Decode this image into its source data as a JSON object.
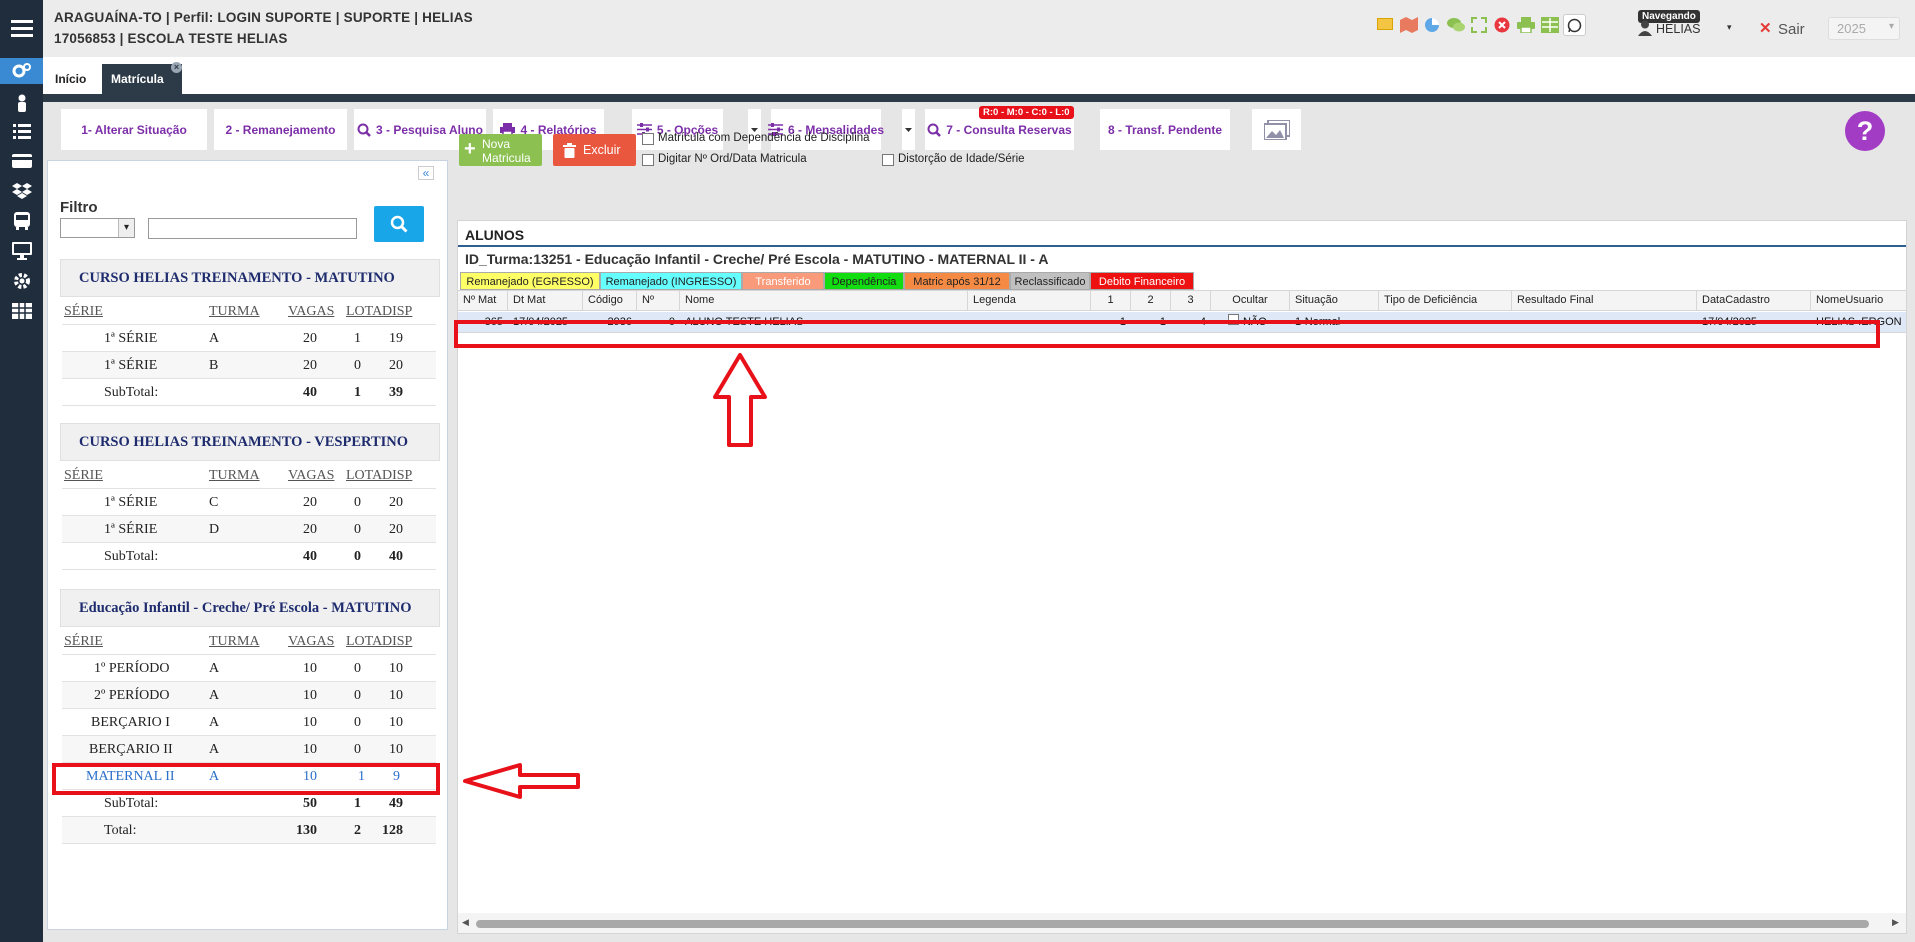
{
  "header": {
    "line1": "ARAGUAÍNA-TO | Perfil: LOGIN SUPORTE | SUPORTE | HELIAS",
    "line2": "17056853 | ESCOLA TESTE HELIAS",
    "user": "HELIAS",
    "navegando_badge": "Navegando",
    "exit_label": "Sair",
    "year": "2025"
  },
  "tabs": [
    {
      "label": "Início"
    },
    {
      "label": "Matrícula"
    }
  ],
  "toolbar": {
    "btn1": "1- Alterar Situação",
    "btn2": "2 - Remanejamento",
    "btn3": "3 - Pesquisa Aluno",
    "btn4": "4 - Relatórios",
    "btn5": "5 - Opções",
    "btn6": "6 - Mensalidades",
    "btn7": "7 - Consulta Reservas",
    "btn7_badge": "R:0 - M:0 - C:0 - L:0",
    "btn8": "8 - Transf. Pendente"
  },
  "filter": {
    "label": "Filtro",
    "select_value": "",
    "search_value": ""
  },
  "courses": [
    {
      "title": "CURSO HELIAS TREINAMENTO - MATUTINO",
      "headers": [
        "SÉRIE",
        "TURMA",
        "VAGAS",
        "LOTA",
        "DISP"
      ],
      "rows": [
        [
          "1ª SÉRIE",
          "A",
          "20",
          "1",
          "19"
        ],
        [
          "1ª SÉRIE",
          "B",
          "20",
          "0",
          "20"
        ]
      ],
      "subtotal": [
        "SubTotal:",
        "40",
        "1",
        "39"
      ]
    },
    {
      "title": "CURSO HELIAS TREINAMENTO - VESPERTINO",
      "headers": [
        "SÉRIE",
        "TURMA",
        "VAGAS",
        "LOTA",
        "DISP"
      ],
      "rows": [
        [
          "1ª SÉRIE",
          "C",
          "20",
          "0",
          "20"
        ],
        [
          "1ª SÉRIE",
          "D",
          "20",
          "0",
          "20"
        ]
      ],
      "subtotal": [
        "SubTotal:",
        "40",
        "0",
        "40"
      ]
    },
    {
      "title": "Educação Infantil - Creche/ Pré Escola - MATUTINO",
      "headers": [
        "SÉRIE",
        "TURMA",
        "VAGAS",
        "LOTA",
        "DISP"
      ],
      "rows": [
        [
          "1º PERÍODO",
          "A",
          "10",
          "0",
          "10"
        ],
        [
          "2º PERÍODO",
          "A",
          "10",
          "0",
          "10"
        ],
        [
          "BERÇARIO I",
          "A",
          "10",
          "0",
          "10"
        ],
        [
          "BERÇARIO II",
          "A",
          "10",
          "0",
          "10"
        ],
        [
          "MATERNAL II",
          "A",
          "10",
          "1",
          "9"
        ]
      ],
      "subtotal": [
        "SubTotal:",
        "50",
        "1",
        "49"
      ],
      "total": [
        "Total:",
        "130",
        "2",
        "128"
      ]
    }
  ],
  "actions": {
    "nova_matricula_line1": "Nova",
    "nova_matricula_line2": "Matricula",
    "excluir": "Excluir",
    "chk1": "Matrícula com Dependência de Disciplina",
    "chk2": "Digitar Nº Ord/Data Matricula",
    "chk3": "Distorção de Idade/Série"
  },
  "alunos": {
    "title": "ALUNOS",
    "turma": "ID_Turma:13251 - Educação Infantil - Creche/ Pré Escola - MATUTINO - MATERNAL II - A",
    "legend": [
      {
        "label": "Remanejado (EGRESSO)",
        "color": "#ffff66",
        "text": "#222"
      },
      {
        "label": "Remanejado (INGRESSO)",
        "color": "#66ffff",
        "text": "#222"
      },
      {
        "label": "Transferido",
        "color": "#f99a7a",
        "text": "#ffffff"
      },
      {
        "label": "Dependência",
        "color": "#11dd11",
        "text": "#222"
      },
      {
        "label": "Matric após 31/12",
        "color": "#f58a44",
        "text": "#222"
      },
      {
        "label": "Reclassificado",
        "color": "#c0c0c0",
        "text": "#222"
      },
      {
        "label": "Debito Financeiro",
        "color": "#ee1111",
        "text": "#ffffff"
      }
    ],
    "columns": [
      "Nº Mat",
      "Dt Mat",
      "Código",
      "Nº",
      "Nome",
      "Legenda",
      "1",
      "2",
      "3",
      "Ocultar",
      "Situação",
      "Tipo de Deficiência",
      "Resultado Final",
      "DataCadastro",
      "NomeUsuario"
    ],
    "row": {
      "nmat": "365",
      "dtmat": "17/04/2025",
      "codigo": "2936",
      "n": "0",
      "nome": "ALUNO TESTE HELIAS",
      "legenda": "",
      "c1": "1",
      "c2": "1",
      "c3": "4",
      "ocultar": "NÃO",
      "situacao": "1-Normal",
      "tipo_def": "",
      "resultado": "",
      "datacadastro": "17/04/2025",
      "nomeusuario": "HELIAS .ERGON"
    }
  },
  "colors": {
    "sidebar": "#1f2d3d",
    "accent_purple": "#7c2ea8",
    "help": "#a33cc4",
    "nova": "#8cc152",
    "excluir": "#e9573f",
    "search_btn": "#18a6e8",
    "highlight": "#e8111a"
  }
}
